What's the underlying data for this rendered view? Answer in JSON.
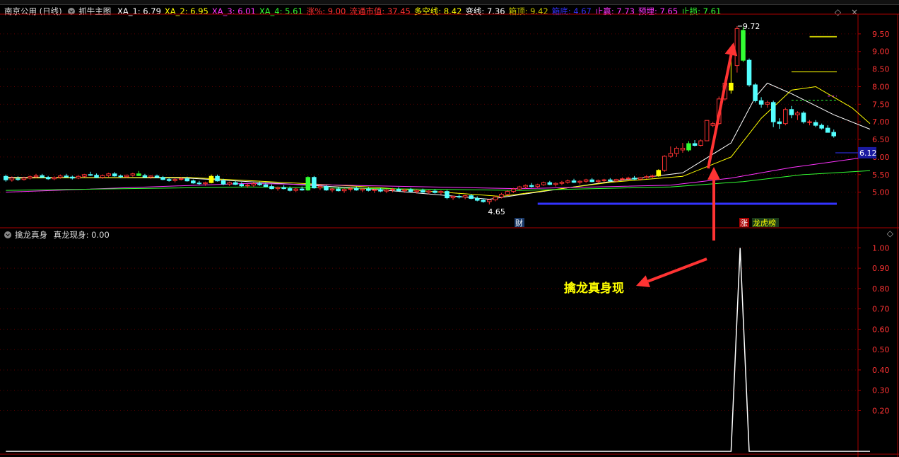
{
  "header": {
    "stock_title": "南京公用 (日线)",
    "indicator_name": "抓牛主图",
    "items": [
      {
        "label": "XA_1: 6.79",
        "color": "#ffffff"
      },
      {
        "label": "XA_2: 6.95",
        "color": "#ffff00"
      },
      {
        "label": "XA_3: 6.01",
        "color": "#ff33ff"
      },
      {
        "label": "XA_4: 5.61",
        "color": "#33ff33"
      },
      {
        "label": "涨%: 9.00",
        "color": "#ff3333"
      },
      {
        "label": "流通市值: 37.45",
        "color": "#ff3333"
      },
      {
        "label": "多空线: 8.42",
        "color": "#ffff00"
      },
      {
        "label": "变线: 7.36",
        "color": "#ffffff"
      },
      {
        "label": "箱顶: 9.42",
        "color": "#c8c800"
      },
      {
        "label": "箱底: 4.67",
        "color": "#3333ff"
      },
      {
        "label": "止赢: 7.73",
        "color": "#ff33ff"
      },
      {
        "label": "预埋: 7.65",
        "color": "#ff33ff"
      },
      {
        "label": "止损: 7.61",
        "color": "#33ff33"
      }
    ]
  },
  "sub_header": {
    "indicator_name": "擒龙真身",
    "value_label": "真龙现身: 0.00"
  },
  "annotation": {
    "text": "擒龙真身现",
    "color": "#ffff00"
  },
  "price_labels": {
    "high": "9.72",
    "low": "4.65",
    "current": "6.12"
  },
  "event_markers": {
    "cai": "财",
    "zhang": "涨",
    "longhu": "龙虎榜"
  },
  "colors": {
    "up": "#ff3333",
    "down": "#54ffff",
    "border": "#aa0000",
    "bg": "#000000"
  },
  "chart_data": [
    {
      "type": "candlestick",
      "title": "",
      "y_ticks": [
        "9.50",
        "9.00",
        "8.50",
        "8.00",
        "7.50",
        "7.00",
        "6.50",
        "6.00",
        "5.50",
        "5.00"
      ],
      "ylim": [
        4.55,
        9.9
      ],
      "note": "ohlc = [open, high, low, close]; colors: 1=up(red hollow), -1=down(cyan filled), 2=yellow, 3=green",
      "candles": [
        [
          5.45,
          5.5,
          5.3,
          5.35,
          -1
        ],
        [
          5.35,
          5.45,
          5.3,
          5.4,
          1
        ],
        [
          5.38,
          5.45,
          5.32,
          5.36,
          -1
        ],
        [
          5.36,
          5.44,
          5.33,
          5.4,
          1
        ],
        [
          5.4,
          5.48,
          5.36,
          5.44,
          1
        ],
        [
          5.44,
          5.52,
          5.4,
          5.47,
          1
        ],
        [
          5.47,
          5.52,
          5.4,
          5.42,
          -1
        ],
        [
          5.42,
          5.46,
          5.35,
          5.38,
          -1
        ],
        [
          5.38,
          5.45,
          5.34,
          5.42,
          1
        ],
        [
          5.42,
          5.5,
          5.38,
          5.46,
          1
        ],
        [
          5.46,
          5.52,
          5.41,
          5.43,
          -1
        ],
        [
          5.43,
          5.47,
          5.36,
          5.4,
          -1
        ],
        [
          5.4,
          5.48,
          5.37,
          5.45,
          1
        ],
        [
          5.45,
          5.52,
          5.42,
          5.5,
          1
        ],
        [
          5.5,
          5.58,
          5.46,
          5.48,
          -1
        ],
        [
          5.48,
          5.53,
          5.4,
          5.42,
          -1
        ],
        [
          5.42,
          5.5,
          5.38,
          5.47,
          1
        ],
        [
          5.47,
          5.55,
          5.43,
          5.52,
          1
        ],
        [
          5.52,
          5.57,
          5.44,
          5.46,
          -1
        ],
        [
          5.46,
          5.5,
          5.4,
          5.44,
          -1
        ],
        [
          5.44,
          5.5,
          5.4,
          5.48,
          1
        ],
        [
          5.48,
          5.55,
          5.44,
          5.52,
          1
        ],
        [
          5.52,
          5.6,
          5.46,
          5.47,
          3
        ],
        [
          5.47,
          5.52,
          5.4,
          5.43,
          -1
        ],
        [
          5.43,
          5.48,
          5.38,
          5.46,
          1
        ],
        [
          5.46,
          5.5,
          5.4,
          5.42,
          -1
        ],
        [
          5.42,
          5.46,
          5.34,
          5.36,
          -1
        ],
        [
          5.36,
          5.4,
          5.3,
          5.33,
          -1
        ],
        [
          5.33,
          5.4,
          5.28,
          5.36,
          1
        ],
        [
          5.36,
          5.42,
          5.33,
          5.38,
          1
        ],
        [
          5.38,
          5.44,
          5.3,
          5.32,
          -1
        ],
        [
          5.32,
          5.36,
          5.24,
          5.26,
          -1
        ],
        [
          5.26,
          5.32,
          5.2,
          5.24,
          -1
        ],
        [
          5.24,
          5.3,
          5.18,
          5.27,
          1
        ],
        [
          5.27,
          5.5,
          5.25,
          5.45,
          2
        ],
        [
          5.45,
          5.5,
          5.3,
          5.32,
          -1
        ],
        [
          5.32,
          5.38,
          5.2,
          5.23,
          -1
        ],
        [
          5.23,
          5.3,
          5.18,
          5.27,
          1
        ],
        [
          5.27,
          5.33,
          5.2,
          5.22,
          -1
        ],
        [
          5.22,
          5.28,
          5.15,
          5.18,
          -1
        ],
        [
          5.18,
          5.24,
          5.12,
          5.2,
          1
        ],
        [
          5.2,
          5.28,
          5.15,
          5.24,
          1
        ],
        [
          5.24,
          5.3,
          5.18,
          5.21,
          -1
        ],
        [
          5.21,
          5.26,
          5.14,
          5.16,
          -1
        ],
        [
          5.16,
          5.22,
          5.08,
          5.1,
          -1
        ],
        [
          5.1,
          5.16,
          5.04,
          5.13,
          1
        ],
        [
          5.13,
          5.2,
          5.08,
          5.1,
          -1
        ],
        [
          5.1,
          5.16,
          5.02,
          5.05,
          -1
        ],
        [
          5.05,
          5.12,
          5.0,
          5.09,
          1
        ],
        [
          5.09,
          5.16,
          5.04,
          5.06,
          -1
        ],
        [
          5.06,
          5.45,
          5.04,
          5.42,
          3
        ],
        [
          5.42,
          5.46,
          5.1,
          5.12,
          -1
        ],
        [
          5.12,
          5.2,
          5.06,
          5.16,
          1
        ],
        [
          5.16,
          5.2,
          5.04,
          5.06,
          -1
        ],
        [
          5.06,
          5.12,
          5.0,
          5.09,
          1
        ],
        [
          5.09,
          5.14,
          5.02,
          5.04,
          -1
        ],
        [
          5.04,
          5.12,
          4.98,
          5.08,
          1
        ],
        [
          5.08,
          5.15,
          5.02,
          5.1,
          1
        ],
        [
          5.1,
          5.16,
          5.04,
          5.06,
          -1
        ],
        [
          5.06,
          5.12,
          5.0,
          5.09,
          1
        ],
        [
          5.09,
          5.14,
          5.02,
          5.05,
          -1
        ],
        [
          5.05,
          5.1,
          4.98,
          5.07,
          1
        ],
        [
          5.07,
          5.12,
          5.0,
          5.03,
          -1
        ],
        [
          5.03,
          5.09,
          4.97,
          5.06,
          1
        ],
        [
          5.06,
          5.12,
          5.0,
          5.08,
          1
        ],
        [
          5.08,
          5.14,
          5.02,
          5.04,
          -1
        ],
        [
          5.04,
          5.1,
          4.98,
          5.07,
          1
        ],
        [
          5.07,
          5.12,
          5.0,
          5.02,
          -1
        ],
        [
          5.02,
          5.08,
          4.96,
          5.05,
          1
        ],
        [
          5.05,
          5.1,
          4.98,
          5.0,
          -1
        ],
        [
          5.0,
          5.06,
          4.94,
          5.03,
          1
        ],
        [
          5.03,
          5.08,
          4.96,
          4.99,
          -1
        ],
        [
          4.99,
          5.05,
          4.93,
          5.02,
          1
        ],
        [
          5.02,
          5.06,
          4.8,
          4.84,
          -1
        ],
        [
          4.84,
          4.9,
          4.78,
          4.88,
          1
        ],
        [
          4.88,
          4.94,
          4.82,
          4.86,
          -1
        ],
        [
          4.86,
          4.92,
          4.8,
          4.9,
          1
        ],
        [
          4.9,
          4.95,
          4.8,
          4.82,
          -1
        ],
        [
          4.82,
          4.88,
          4.74,
          4.77,
          -1
        ],
        [
          4.77,
          4.82,
          4.7,
          4.73,
          -1
        ],
        [
          4.73,
          4.8,
          4.65,
          4.78,
          1
        ],
        [
          4.78,
          4.9,
          4.74,
          4.86,
          1
        ],
        [
          4.86,
          4.98,
          4.82,
          4.94,
          1
        ],
        [
          4.94,
          5.06,
          4.9,
          5.02,
          1
        ],
        [
          5.02,
          5.12,
          4.98,
          5.09,
          1
        ],
        [
          5.09,
          5.18,
          5.05,
          5.15,
          1
        ],
        [
          5.15,
          5.22,
          5.1,
          5.19,
          1
        ],
        [
          5.19,
          5.26,
          5.13,
          5.16,
          -1
        ],
        [
          5.16,
          5.24,
          5.12,
          5.21,
          1
        ],
        [
          5.21,
          5.3,
          5.18,
          5.27,
          1
        ],
        [
          5.27,
          5.32,
          5.2,
          5.22,
          -1
        ],
        [
          5.22,
          5.28,
          5.16,
          5.25,
          1
        ],
        [
          5.25,
          5.32,
          5.2,
          5.28,
          1
        ],
        [
          5.28,
          5.36,
          5.24,
          5.32,
          1
        ],
        [
          5.32,
          5.38,
          5.26,
          5.28,
          -1
        ],
        [
          5.28,
          5.34,
          5.22,
          5.31,
          1
        ],
        [
          5.31,
          5.38,
          5.27,
          5.35,
          1
        ],
        [
          5.35,
          5.4,
          5.28,
          5.3,
          -1
        ],
        [
          5.3,
          5.36,
          5.25,
          5.33,
          1
        ],
        [
          5.33,
          5.38,
          5.28,
          5.35,
          1
        ],
        [
          5.35,
          5.4,
          5.3,
          5.32,
          -1
        ],
        [
          5.32,
          5.38,
          5.28,
          5.36,
          1
        ],
        [
          5.36,
          5.42,
          5.32,
          5.38,
          1
        ],
        [
          5.38,
          5.44,
          5.34,
          5.4,
          1
        ],
        [
          5.4,
          5.46,
          5.35,
          5.37,
          -1
        ],
        [
          5.37,
          5.43,
          5.33,
          5.41,
          1
        ],
        [
          5.41,
          5.48,
          5.38,
          5.44,
          1
        ],
        [
          5.44,
          5.5,
          5.4,
          5.46,
          1
        ],
        [
          5.46,
          5.65,
          5.44,
          5.62,
          2
        ],
        [
          5.62,
          6.05,
          5.58,
          6.02,
          1
        ],
        [
          6.02,
          6.3,
          5.98,
          6.1,
          1
        ],
        [
          6.1,
          6.3,
          6.0,
          6.25,
          1
        ],
        [
          6.25,
          6.4,
          6.12,
          6.2,
          1
        ],
        [
          6.2,
          6.45,
          6.15,
          6.38,
          3
        ],
        [
          6.38,
          6.48,
          6.3,
          6.33,
          -1
        ],
        [
          6.33,
          6.5,
          6.3,
          6.46,
          1
        ],
        [
          6.46,
          7.04,
          6.46,
          7.04,
          1
        ],
        [
          6.9,
          7.0,
          6.85,
          6.95,
          1
        ],
        [
          6.95,
          7.72,
          6.92,
          7.65,
          1
        ],
        [
          7.65,
          8.2,
          7.6,
          8.1,
          1
        ],
        [
          8.1,
          8.85,
          7.8,
          7.9,
          2
        ],
        [
          8.6,
          9.72,
          8.4,
          9.65,
          1
        ],
        [
          9.6,
          9.7,
          8.7,
          8.75,
          3
        ],
        [
          8.75,
          8.8,
          8.0,
          8.05,
          -1
        ],
        [
          8.05,
          8.1,
          7.55,
          7.6,
          -1
        ],
        [
          7.6,
          7.7,
          7.4,
          7.5,
          -1
        ],
        [
          7.5,
          7.6,
          7.4,
          7.55,
          1
        ],
        [
          7.55,
          7.6,
          6.85,
          7.0,
          -1
        ],
        [
          7.0,
          7.1,
          6.8,
          6.95,
          -1
        ],
        [
          6.95,
          7.4,
          6.9,
          7.35,
          1
        ],
        [
          7.35,
          7.45,
          7.1,
          7.2,
          -1
        ],
        [
          7.2,
          7.3,
          7.05,
          7.25,
          1
        ],
        [
          7.25,
          7.3,
          6.95,
          7.0,
          -1
        ],
        [
          7.0,
          7.05,
          6.9,
          6.98,
          1
        ],
        [
          6.98,
          7.05,
          6.85,
          6.9,
          -1
        ],
        [
          6.9,
          6.95,
          6.78,
          6.82,
          -1
        ],
        [
          6.82,
          6.9,
          6.72,
          6.7,
          -1
        ],
        [
          6.7,
          6.78,
          6.55,
          6.6,
          -1
        ]
      ],
      "lines": [
        {
          "name": "XA_1",
          "color": "#ffffff",
          "values": [
            [
              0,
              5.42
            ],
            [
              30,
              5.4
            ],
            [
              60,
              5.1
            ],
            [
              80,
              4.8
            ],
            [
              100,
              5.3
            ],
            [
              112,
              5.55
            ],
            [
              120,
              6.4
            ],
            [
              124,
              7.7
            ],
            [
              126,
              8.1
            ],
            [
              130,
              7.8
            ],
            [
              137,
              7.2
            ],
            [
              143,
              6.79
            ]
          ]
        },
        {
          "name": "XA_2",
          "color": "#ffff00",
          "values": [
            [
              0,
              5.4
            ],
            [
              30,
              5.42
            ],
            [
              60,
              5.15
            ],
            [
              82,
              4.88
            ],
            [
              100,
              5.28
            ],
            [
              112,
              5.45
            ],
            [
              120,
              6.0
            ],
            [
              125,
              7.1
            ],
            [
              130,
              7.9
            ],
            [
              134,
              8.0
            ],
            [
              140,
              7.4
            ],
            [
              143,
              6.95
            ]
          ]
        },
        {
          "name": "XA_3",
          "color": "#ff33ff",
          "values": [
            [
              0,
              5.0
            ],
            [
              40,
              5.25
            ],
            [
              85,
              5.1
            ],
            [
              110,
              5.2
            ],
            [
              120,
              5.4
            ],
            [
              130,
              5.7
            ],
            [
              143,
              6.01
            ]
          ]
        },
        {
          "name": "XA_4",
          "color": "#33ff33",
          "values": [
            [
              0,
              5.05
            ],
            [
              40,
              5.15
            ],
            [
              85,
              5.05
            ],
            [
              110,
              5.15
            ],
            [
              122,
              5.3
            ],
            [
              132,
              5.5
            ],
            [
              143,
              5.61
            ]
          ]
        }
      ],
      "levels": [
        {
          "name": "箱顶",
          "value": 9.42,
          "color": "#c8c800",
          "from": 133
        },
        {
          "name": "多空线",
          "value": 8.42,
          "color": "#ffff00",
          "from": 130
        },
        {
          "name": "箱底",
          "value": 4.67,
          "color": "#3333ff",
          "from": 88
        },
        {
          "name": "止赢",
          "value": 7.73,
          "color": "#ff33ff",
          "from": 136
        },
        {
          "name": "止损",
          "value": 7.61,
          "color": "#33ff33",
          "from": 130
        }
      ]
    },
    {
      "type": "line",
      "title": "擒龙真身",
      "series": [
        {
          "name": "真龙现身",
          "color": "#ffffff",
          "values": [
            [
              0,
              0
            ],
            [
              120,
              0
            ],
            [
              121.5,
              1.0
            ],
            [
              123,
              0
            ],
            [
              143,
              0
            ]
          ]
        }
      ],
      "y_ticks": [
        "1.00",
        "0.90",
        "0.80",
        "0.70",
        "0.60",
        "0.50",
        "0.40",
        "0.30",
        "0.20"
      ],
      "ylim": [
        0,
        1.05
      ]
    }
  ]
}
